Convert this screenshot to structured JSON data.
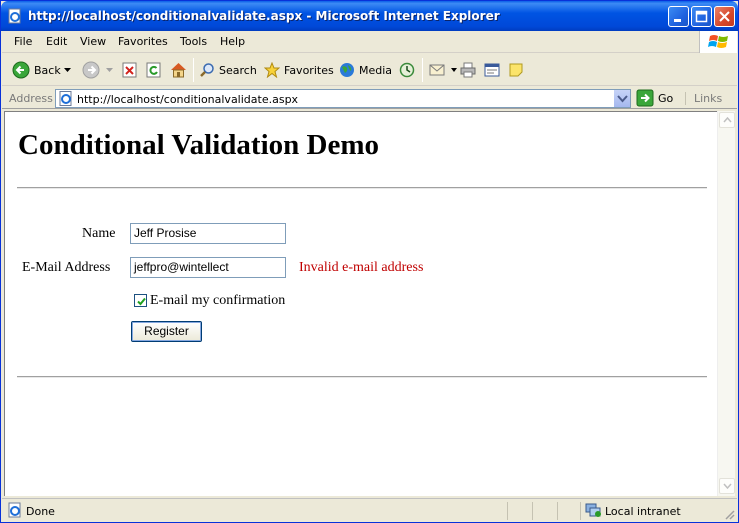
{
  "window": {
    "title": "http://localhost/conditionalvalidate.aspx - Microsoft Internet Explorer"
  },
  "menu": [
    "File",
    "Edit",
    "View",
    "Favorites",
    "Tools",
    "Help"
  ],
  "toolbar": {
    "back": "Back",
    "search": "Search",
    "favorites": "Favorites",
    "media": "Media"
  },
  "address": {
    "label": "Address",
    "url": "http://localhost/conditionalvalidate.aspx",
    "go": "Go",
    "links": "Links"
  },
  "page": {
    "title": "Conditional Validation Demo",
    "name_label": "Name",
    "name_value": "Jeff Prosise",
    "email_label": "E-Mail Address",
    "email_value": "jeffpro@wintellect",
    "email_error": "Invalid e-mail address",
    "confirm_label": "E-mail my confirmation",
    "confirm_checked": true,
    "register_label": "Register"
  },
  "status": {
    "text": "Done",
    "zone": "Local intranet"
  },
  "colors": {
    "titlebar": "#0054e3",
    "error": "#c00000"
  }
}
